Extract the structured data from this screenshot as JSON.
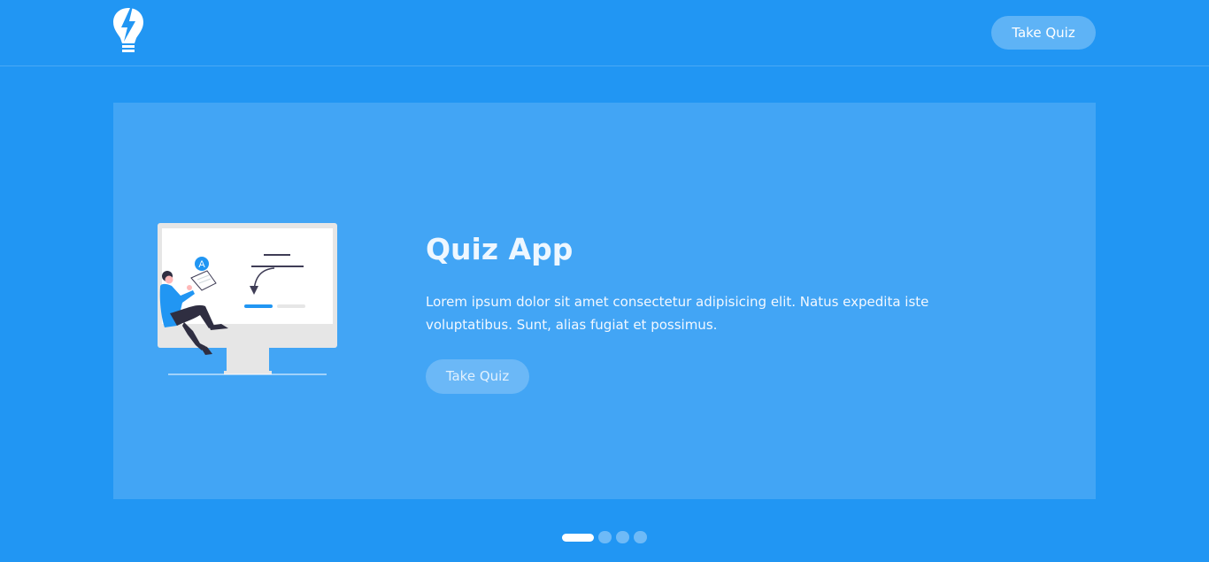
{
  "navbar": {
    "logo_icon": "lightbulb-bolt-icon",
    "take_quiz_label": "Take Quiz"
  },
  "carousel": {
    "slides": [
      {
        "title": "Quiz App",
        "description": "Lorem ipsum dolor sit amet consectetur adipisicing elit. Natus expedita iste voluptatibus. Sunt, alias fugiat et possimus.",
        "button_label": "Take Quiz",
        "illustration": "person-taking-quiz-on-monitor-illustration",
        "illustration_badge": "A"
      }
    ],
    "active_index": 0,
    "indicator_count": 4
  },
  "colors": {
    "background": "#2196f3",
    "slide": "#42a5f5",
    "accent": "#ffffff"
  }
}
